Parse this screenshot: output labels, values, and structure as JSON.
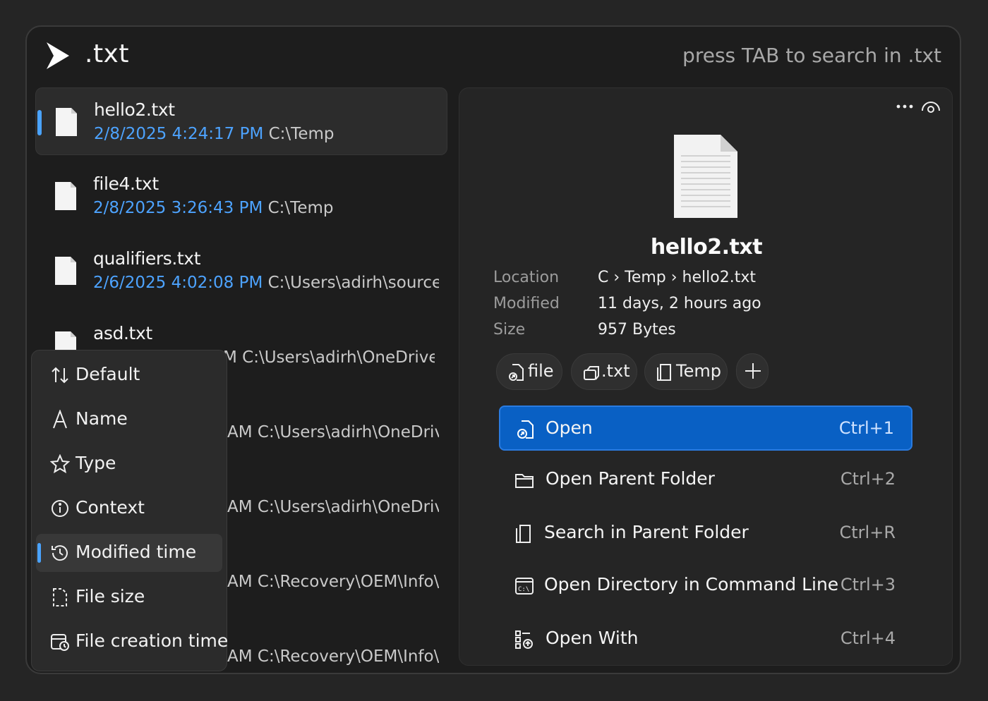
{
  "search": {
    "query": ".txt",
    "hint": "press TAB to search in .txt"
  },
  "results": [
    {
      "name": "hello2.txt",
      "date": "2/8/2025 4:24:17 PM",
      "path": "C:\\Temp"
    },
    {
      "name": "file4.txt",
      "date": "2/8/2025 3:26:43 PM",
      "path": "C:\\Temp"
    },
    {
      "name": "qualifiers.txt",
      "date": "2/6/2025 4:02:08 PM",
      "path": "C:\\Users\\adirh\\source\\repo"
    },
    {
      "name": "asd.txt",
      "date": "",
      "path": "M C:\\Users\\adirh\\OneDrive\\D"
    },
    {
      "name": "",
      "date": "",
      "path": "AM C:\\Users\\adirh\\OneDrive\\["
    },
    {
      "name": "",
      "date": "",
      "path": "AM C:\\Users\\adirh\\OneDrive\\I"
    },
    {
      "name": "",
      "date": "",
      "path": "AM C:\\Recovery\\OEM\\Info\\de"
    },
    {
      "name": "",
      "date": "",
      "path": "AM C:\\Recovery\\OEM\\Info\\de"
    }
  ],
  "sort_menu": {
    "items": [
      {
        "label": "Default",
        "icon": "sort-arrows-icon"
      },
      {
        "label": "Name",
        "icon": "letter-a-icon"
      },
      {
        "label": "Type",
        "icon": "star-icon"
      },
      {
        "label": "Context",
        "icon": "info-icon"
      },
      {
        "label": "Modified time",
        "icon": "history-icon"
      },
      {
        "label": "File size",
        "icon": "file-size-icon"
      },
      {
        "label": "File creation time",
        "icon": "calendar-clock-icon"
      }
    ],
    "selected": "Modified time"
  },
  "preview": {
    "title": "hello2.txt",
    "meta": {
      "location_label": "Location",
      "location_value": "C › Temp › hello2.txt",
      "modified_label": "Modified",
      "modified_value": "11 days, 2 hours ago",
      "size_label": "Size",
      "size_value": "957 Bytes"
    },
    "tags": [
      {
        "label": "file",
        "icon": "file-open-icon"
      },
      {
        "label": ".txt",
        "icon": "extension-icon"
      },
      {
        "label": "Temp",
        "icon": "folder-search-icon"
      }
    ],
    "add_tag": "+"
  },
  "actions": [
    {
      "label": "Open",
      "shortcut": "Ctrl+1",
      "icon": "open-file-icon"
    },
    {
      "label": "Open Parent Folder",
      "shortcut": "Ctrl+2",
      "icon": "folder-icon"
    },
    {
      "label": "Search in Parent Folder",
      "shortcut": "Ctrl+R",
      "icon": "folder-search-icon"
    },
    {
      "label": "Open Directory in Command Line",
      "shortcut": "Ctrl+3",
      "icon": "terminal-icon"
    },
    {
      "label": "Open With",
      "shortcut": "Ctrl+4",
      "icon": "open-with-icon"
    }
  ],
  "colors": {
    "accent": "#0960c4",
    "date": "#4da3ff",
    "selection_bar": "#4aa3ff"
  }
}
